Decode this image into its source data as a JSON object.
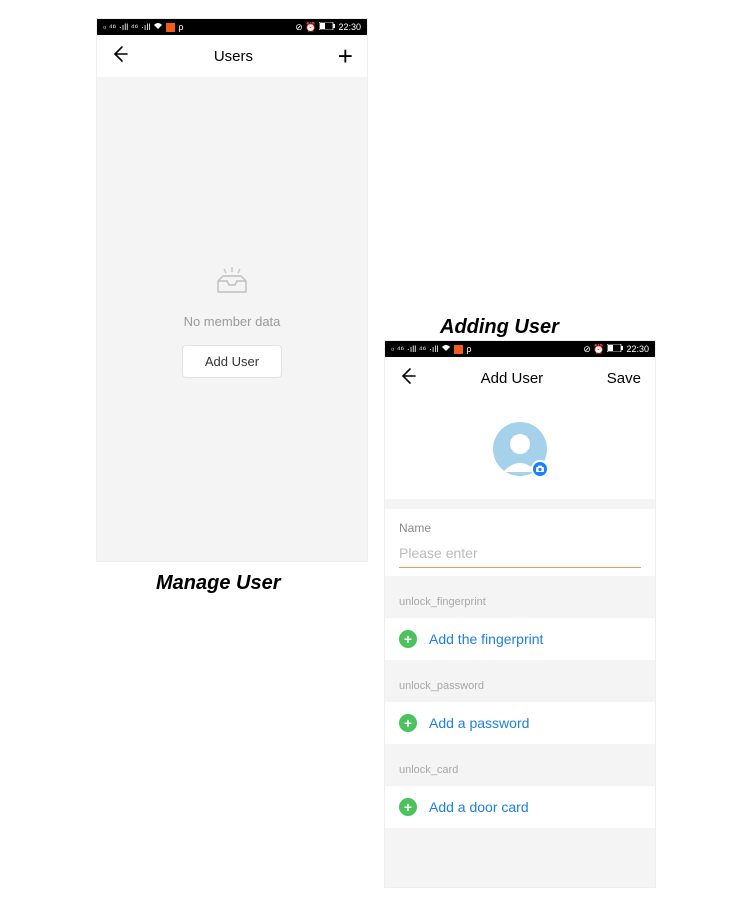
{
  "captions": {
    "left": "Manage User",
    "right": "Adding User"
  },
  "status_bar": {
    "time": "22:30",
    "carrier_icons": "▫ ⁴⁶ ·ıll ⁴⁶ ·ıll",
    "right_icons": "⊘ ⏰"
  },
  "manage_screen": {
    "title": "Users",
    "empty_text": "No member data",
    "add_button": "Add User"
  },
  "add_screen": {
    "title": "Add User",
    "save_label": "Save",
    "name_label": "Name",
    "name_placeholder": "Please enter",
    "options": [
      {
        "header": "unlock_fingerprint",
        "action": "Add the fingerprint"
      },
      {
        "header": "unlock_password",
        "action": "Add a password"
      },
      {
        "header": "unlock_card",
        "action": "Add a door card"
      }
    ]
  },
  "colors": {
    "accent_blue": "#1d7fe2",
    "avatar_bg": "#a6d1eb",
    "plus_green": "#4bc25c",
    "camera_badge": "#1583ff"
  }
}
